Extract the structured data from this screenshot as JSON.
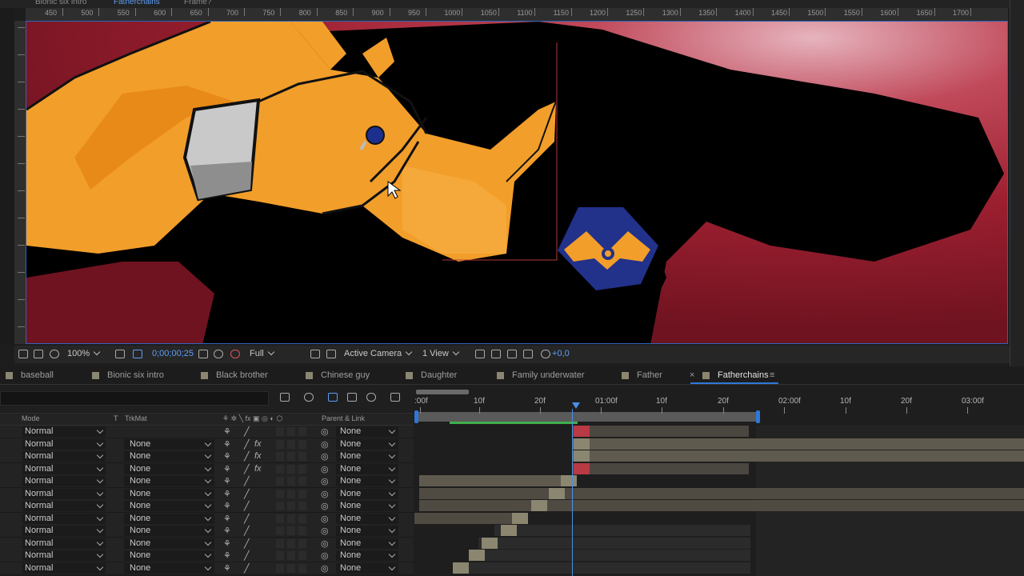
{
  "top_tabs": [
    "Bionic six intro",
    "Fatherchains",
    "Frame?"
  ],
  "ruler_ticks": [
    "450",
    "500",
    "550",
    "600",
    "650",
    "700",
    "750",
    "800",
    "850",
    "900",
    "950",
    "1000",
    "1050",
    "1100",
    "1150",
    "1200",
    "1250",
    "1300",
    "1350",
    "1400",
    "1450",
    "1500",
    "1550",
    "1600",
    "1650",
    "1700"
  ],
  "viewer_toolbar": {
    "zoom": "100%",
    "timecode": "0;00;00;25",
    "resolution": "Full",
    "camera": "Active Camera",
    "views": "1 View",
    "exposure": "+0,0"
  },
  "comp_tabs": [
    {
      "label": "baseball",
      "active": false
    },
    {
      "label": "Bionic six intro",
      "active": false
    },
    {
      "label": "Black brother",
      "active": false
    },
    {
      "label": "Chinese guy",
      "active": false
    },
    {
      "label": "Daughter",
      "active": false
    },
    {
      "label": "Family underwater",
      "active": false
    },
    {
      "label": "Father",
      "active": false
    },
    {
      "label": "Fatherchains",
      "active": true
    }
  ],
  "column_headers": {
    "mode": "Mode",
    "t": "T",
    "trkmat": "TrkMat",
    "parent": "Parent & Link"
  },
  "time_labels": [
    ":00f",
    "10f",
    "20f",
    "01:00f",
    "10f",
    "20f",
    "02:00f",
    "10f",
    "20f",
    "03:00f"
  ],
  "layers": [
    {
      "mode": "Normal",
      "trkmat": "",
      "fx": false,
      "parent": "None"
    },
    {
      "mode": "Normal",
      "trkmat": "None",
      "fx": true,
      "parent": "None"
    },
    {
      "mode": "Normal",
      "trkmat": "None",
      "fx": true,
      "parent": "None"
    },
    {
      "mode": "Normal",
      "trkmat": "None",
      "fx": true,
      "parent": "None"
    },
    {
      "mode": "Normal",
      "trkmat": "None",
      "fx": false,
      "parent": "None"
    },
    {
      "mode": "Normal",
      "trkmat": "None",
      "fx": false,
      "parent": "None"
    },
    {
      "mode": "Normal",
      "trkmat": "None",
      "fx": false,
      "parent": "None"
    },
    {
      "mode": "Normal",
      "trkmat": "None",
      "fx": false,
      "parent": "None"
    },
    {
      "mode": "Normal",
      "trkmat": "None",
      "fx": false,
      "parent": "None"
    },
    {
      "mode": "Normal",
      "trkmat": "None",
      "fx": false,
      "parent": "None"
    },
    {
      "mode": "Normal",
      "trkmat": "None",
      "fx": false,
      "parent": "None"
    },
    {
      "mode": "Normal",
      "trkmat": "None",
      "fx": false,
      "parent": "None"
    }
  ],
  "colors": {
    "accent_blue": "#2f77d9",
    "work_area_green": "#3fb04a",
    "playhead_red": "#b83a44",
    "layer_bar": "#8b8670"
  }
}
